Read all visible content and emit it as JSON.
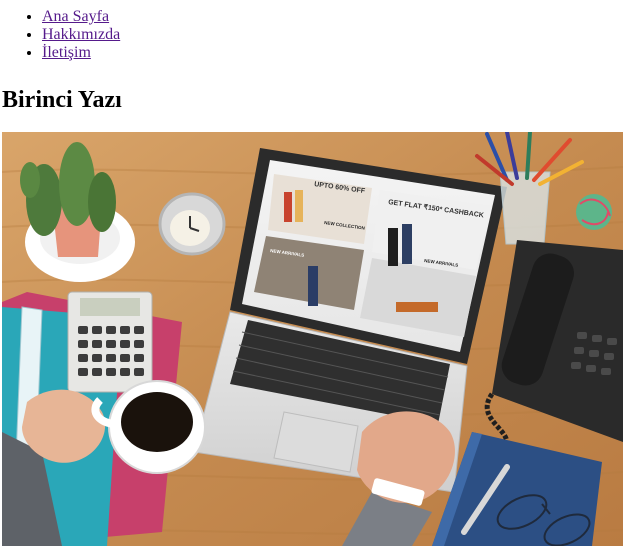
{
  "nav": {
    "items": [
      {
        "label": "Ana Sayfa"
      },
      {
        "label": "Hakkımızda"
      },
      {
        "label": "İletişim"
      }
    ],
    "link_color": "#551a8b"
  },
  "post": {
    "title": "Birinci Yazı"
  },
  "image_content": {
    "screen_texts": {
      "upto": "UPTO 60% OFF",
      "cashback": "GET FLAT ₹150* CASHBACK",
      "new_collection": "NEW COLLECTION",
      "new_arrivals_left": "NEW ARRIVALS",
      "new_arrivals_right": "NEW ARRIVALS"
    }
  }
}
